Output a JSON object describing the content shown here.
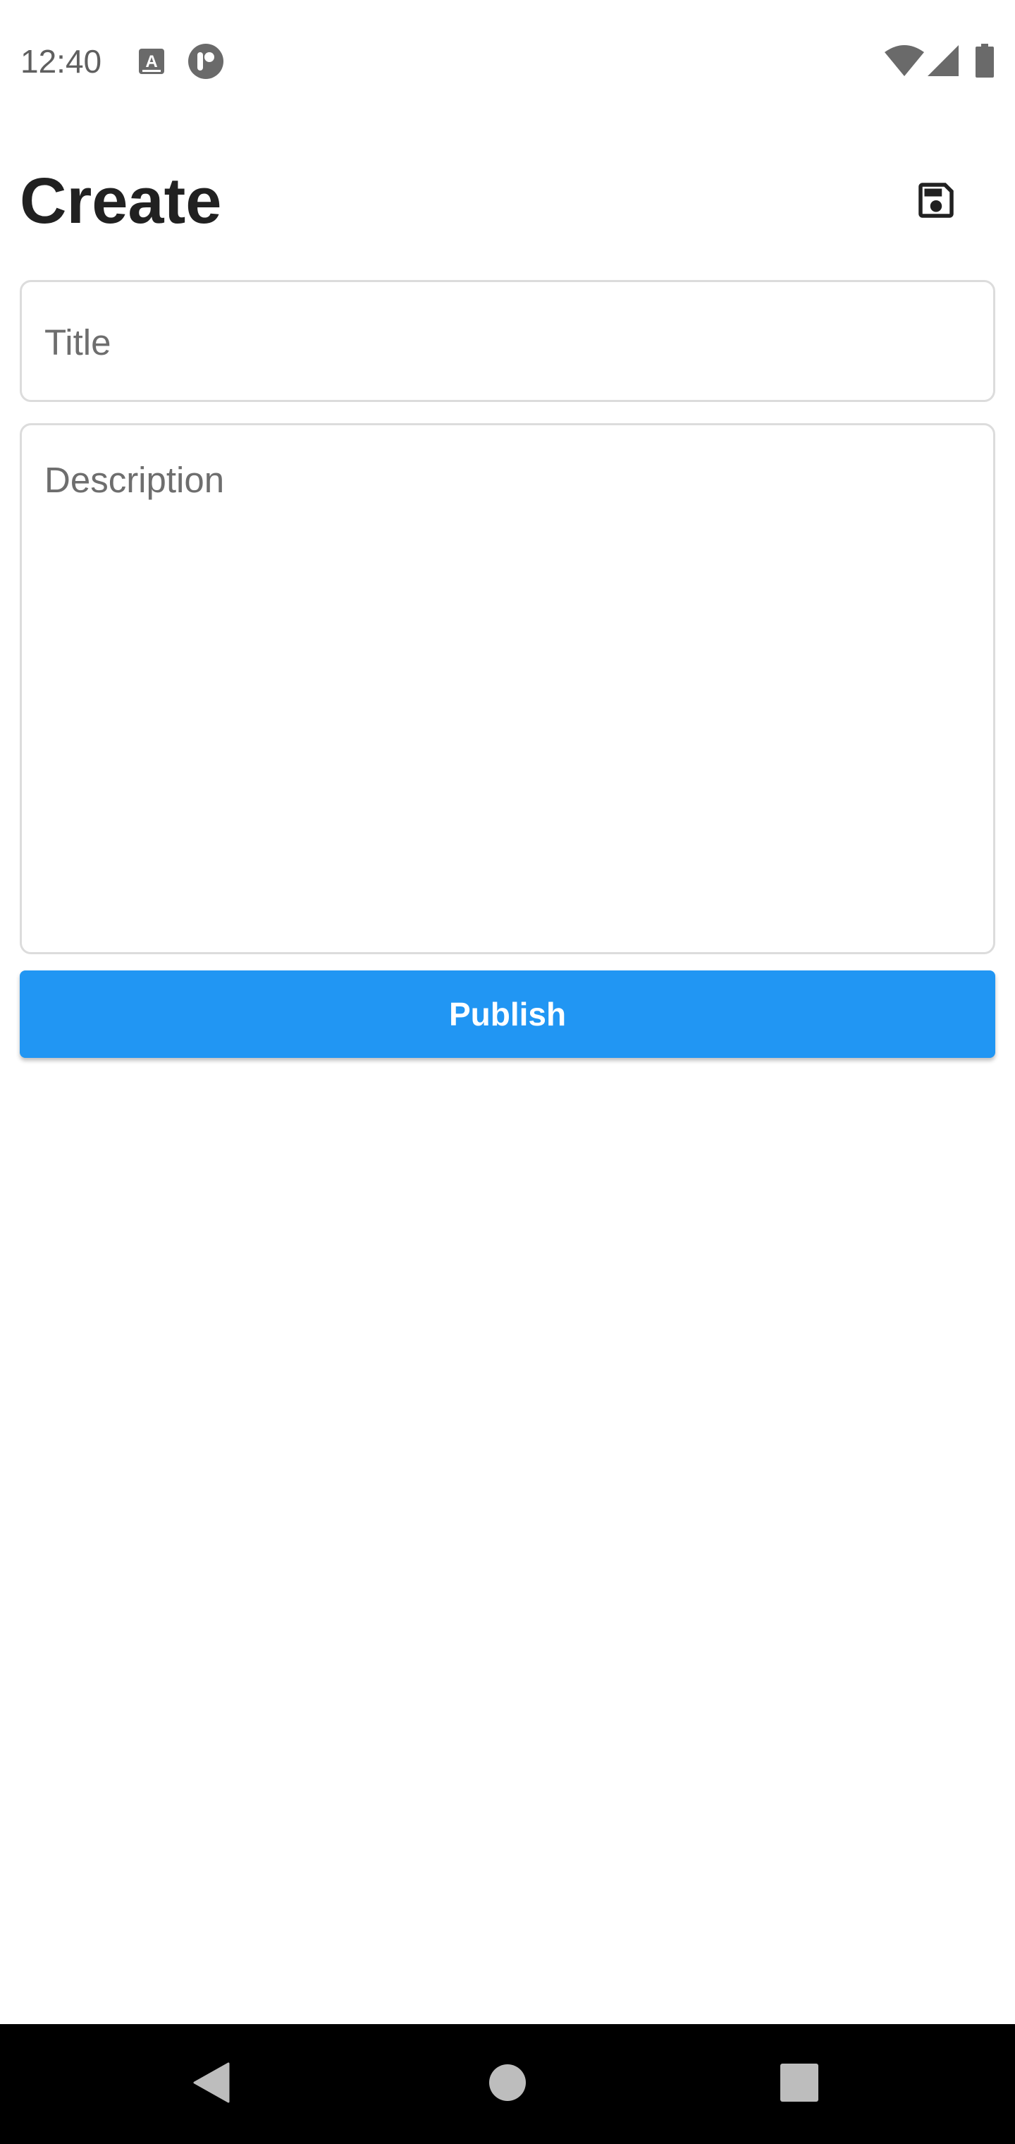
{
  "status_bar": {
    "time": "12:40",
    "left_icons": [
      "font-icon",
      "app-notification-icon"
    ],
    "right_icons": [
      "wifi-icon",
      "signal-icon",
      "battery-icon"
    ]
  },
  "header": {
    "title": "Create",
    "save_icon": "save-icon"
  },
  "form": {
    "title_placeholder": "Title",
    "title_value": "",
    "description_placeholder": "Description",
    "description_value": ""
  },
  "publish_button": {
    "label": "Publish",
    "color": "#2196f3"
  },
  "nav_bar": {
    "icons": [
      "back-icon",
      "home-icon",
      "recents-icon"
    ]
  }
}
